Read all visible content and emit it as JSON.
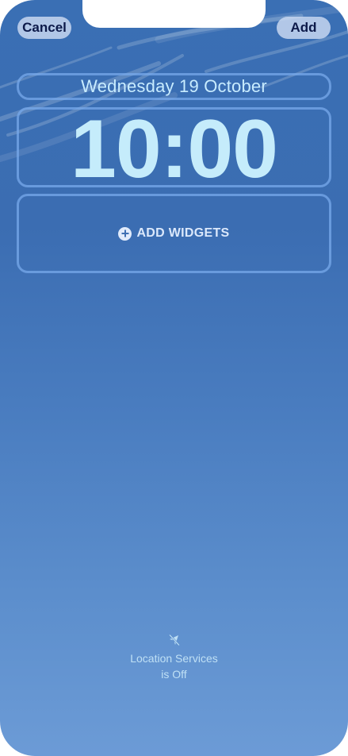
{
  "header": {
    "cancel_label": "Cancel",
    "add_label": "Add"
  },
  "lockscreen": {
    "date": "Wednesday 19 October",
    "time": "10:00",
    "add_widgets_label": "ADD WIDGETS"
  },
  "location": {
    "line1": "Location Services",
    "line2": "is Off",
    "icon": "location-off-icon"
  },
  "colors": {
    "background_top": "#3a6fb4",
    "background_bottom": "#6c9bd6",
    "time_text": "#c5ecfb",
    "button_bg": "#c8d7f0",
    "button_text": "#0d1a4a",
    "outline": "#78aaeb"
  }
}
